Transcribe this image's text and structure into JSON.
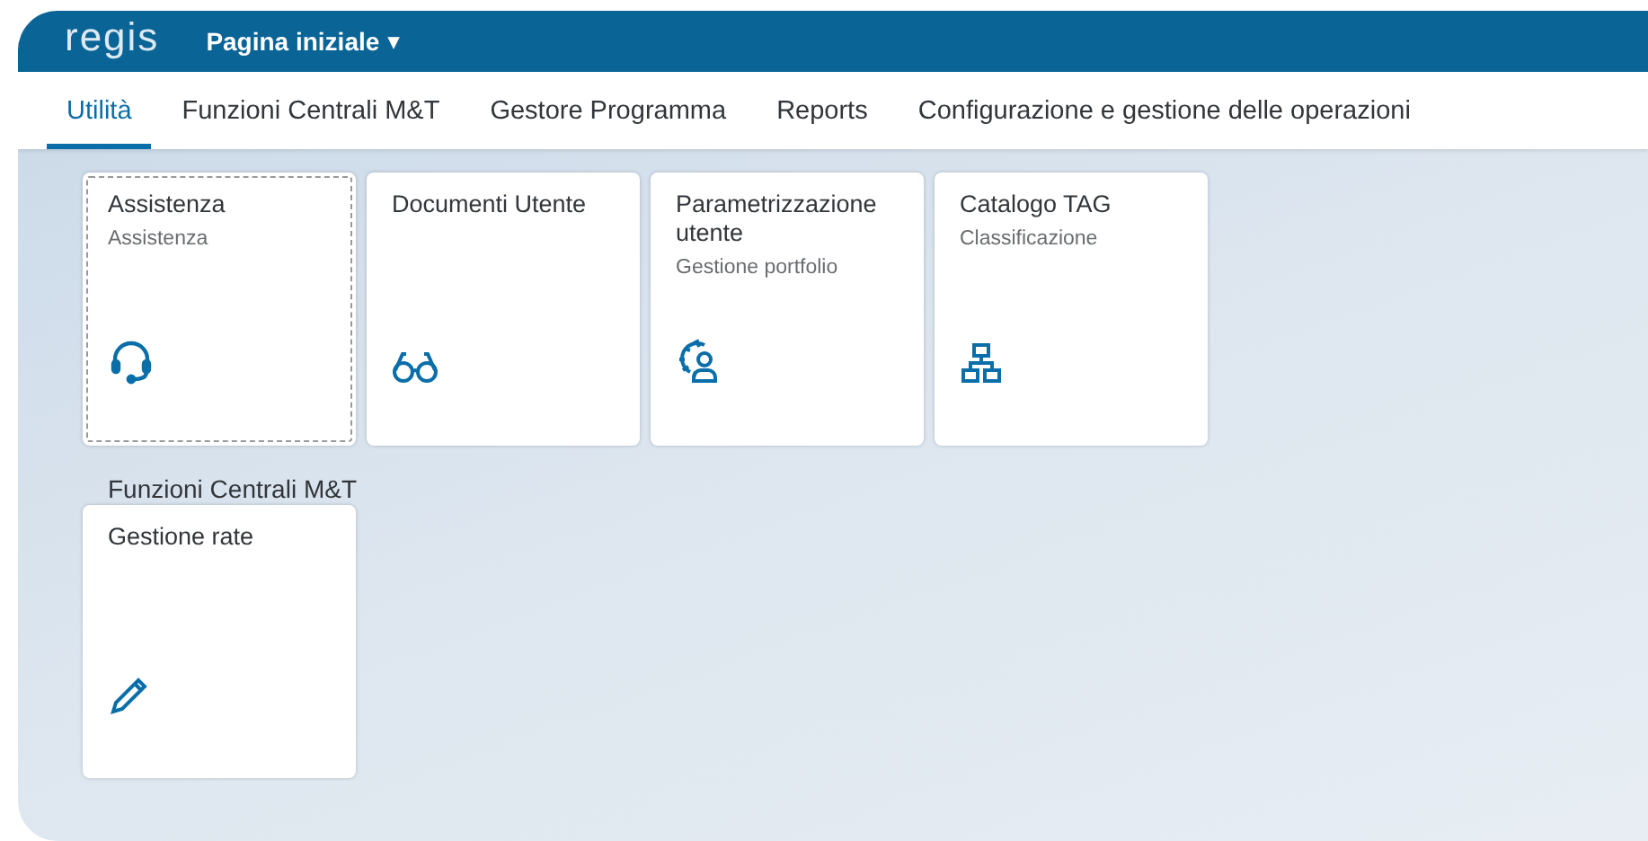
{
  "header": {
    "logo": "regis",
    "title": "Pagina iniziale",
    "menu_arrow": "▾"
  },
  "tabs": [
    {
      "label": "Utilità",
      "selected": true
    },
    {
      "label": "Funzioni Centrali M&T",
      "selected": false
    },
    {
      "label": "Gestore Programma",
      "selected": false
    },
    {
      "label": "Reports",
      "selected": false
    },
    {
      "label": "Configurazione e gestione delle operazioni",
      "selected": false
    }
  ],
  "sections": [
    {
      "tiles": [
        {
          "title": "Assistenza",
          "subtitle": "Assistenza",
          "focused": true
        },
        {
          "title": "Documenti Utente",
          "focused": false
        },
        {
          "title": "Parametrizzazione utente",
          "subtitle": "Gestione portfolio",
          "focused": false
        },
        {
          "title": "Catalogo TAG",
          "subtitle": "Classificazione",
          "focused": false
        }
      ]
    },
    {
      "title": "Funzioni Centrali M&T",
      "tiles": [
        {
          "title": "Gestione rate",
          "focused": false
        }
      ]
    }
  ]
}
